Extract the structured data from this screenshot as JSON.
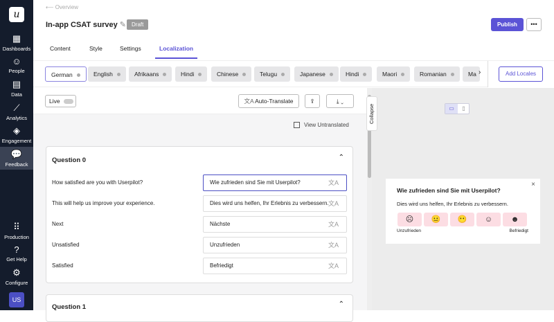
{
  "sidebar": {
    "items": [
      {
        "label": "Dashboards"
      },
      {
        "label": "People"
      },
      {
        "label": "Data"
      },
      {
        "label": "Analytics"
      },
      {
        "label": "Engagement"
      },
      {
        "label": "Feedback"
      },
      {
        "label": "Production"
      },
      {
        "label": "Get Help"
      },
      {
        "label": "Configure"
      }
    ],
    "avatar": "US",
    "logo": "u"
  },
  "header": {
    "breadcrumb": "Overview",
    "title": "In-app CSAT survey",
    "status": "Draft",
    "publish": "Publish",
    "more": "•••"
  },
  "tabs": [
    "Content",
    "Style",
    "Settings",
    "Localization"
  ],
  "locales": [
    "German",
    "English",
    "Afrikaans",
    "Hindi",
    "Chinese",
    "Telugu",
    "Japanese",
    "Hindi",
    "Maori",
    "Romanian",
    "Ma"
  ],
  "add_locales": "Add Locales",
  "toolbar": {
    "live": "Live",
    "auto_translate": "Auto-Translate",
    "view_untranslated": "View Untranslated",
    "collapse": "Collapse"
  },
  "questions": [
    {
      "title": "Question 0",
      "rows": [
        {
          "label": "How satisfied are you with Userpilot?",
          "value": "Wie zufrieden sind Sie mit Userpilot?"
        },
        {
          "label": "This will help us improve your experience.",
          "value": "Dies wird uns helfen, Ihr Erlebnis zu verbessern."
        },
        {
          "label": "Next",
          "value": "Nächste"
        },
        {
          "label": "Unsatisfied",
          "value": "Unzufrieden"
        },
        {
          "label": "Satisfied",
          "value": "Befriedigt"
        }
      ]
    },
    {
      "title": "Question 1"
    }
  ],
  "preview": {
    "title": "Wie zufrieden sind Sie mit Userpilot?",
    "subtitle": "Dies wird uns helfen, Ihr Erlebnis zu verbessern.",
    "low": "Unzufrieden",
    "high": "Befriedigt",
    "faces": [
      "☹",
      "😐",
      "😶",
      "☺",
      "☻"
    ]
  }
}
